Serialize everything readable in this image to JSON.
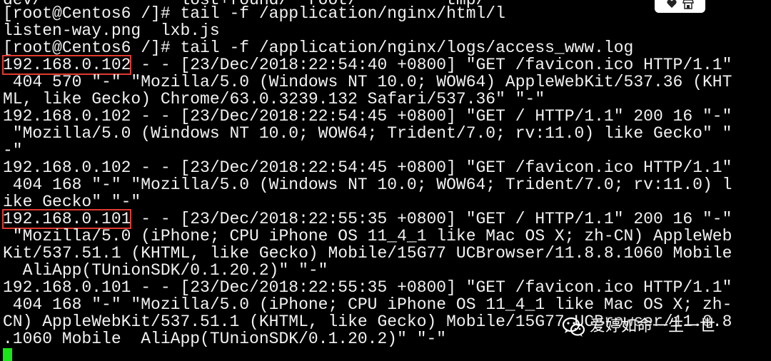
{
  "terminal": {
    "lines": [
      "dev/              lost+found/  root/         tmp/",
      "[root@Centos6 /]# tail -f /application/nginx/html/l",
      "listen-way.png  lxb.js",
      "[root@Centos6 /]# tail -f /application/nginx/logs/access_www.log",
      "192.168.0.102",
      " - - [23/Dec/2018:22:54:40 +0800] \"GET /favicon.ico HTTP/1.1\"",
      " 404 570 \"-\" \"Mozilla/5.0 (Windows NT 10.0; WOW64) AppleWebKit/537.36 (KHT",
      "ML, like Gecko) Chrome/63.0.3239.132 Safari/537.36\" \"-\"",
      "192.168.0.102 - - [23/Dec/2018:22:54:45 +0800] \"GET / HTTP/1.1\" 200 16 \"-\"",
      " \"Mozilla/5.0 (Windows NT 10.0; WOW64; Trident/7.0; rv:11.0) like Gecko\" \"",
      "-\"",
      "192.168.0.102 - - [23/Dec/2018:22:54:45 +0800] \"GET /favicon.ico HTTP/1.1\"",
      " 404 168 \"-\" \"Mozilla/5.0 (Windows NT 10.0; WOW64; Trident/7.0; rv:11.0) l",
      "ike Gecko\" \"-\"",
      "192.168.0.101",
      " - - [23/Dec/2018:22:55:35 +0800] \"GET / HTTP/1.1\" 200 16 \"-\"",
      " \"Mozilla/5.0 (iPhone; CPU iPhone OS 11_4_1 like Mac OS X; zh-CN) AppleWeb",
      "Kit/537.51.1 (KHTML, like Gecko) Mobile/15G77 UCBrowser/11.8.8.1060 Mobile",
      "  AliApp(TUnionSDK/0.1.20.2)\" \"-\"",
      "192.168.0.101 - - [23/Dec/2018:22:55:35 +0800] \"GET /favicon.ico HTTP/1.1\"",
      " 404 168 \"-\" \"Mozilla/5.0 (iPhone; CPU iPhone OS 11_4_1 like Mac OS X; zh-",
      "CN) AppleWebKit/537.51.1 (KHTML, like Gecko) Mobile/15G77 UCBrowser/11.8.8",
      ".1060 Mobile  AliApp(TUnionSDK/0.1.20.2)\" \"-\""
    ]
  },
  "watermark": {
    "text": "爱婷如命一生一世"
  },
  "colors": {
    "background": "#000000",
    "text": "#f2f2f2",
    "highlight_box": "#e03a2e",
    "cursor": "#19e619"
  },
  "icons": {
    "watermark": "wechat-icon",
    "badge": [
      "heart-icon",
      "shop-icon"
    ]
  }
}
